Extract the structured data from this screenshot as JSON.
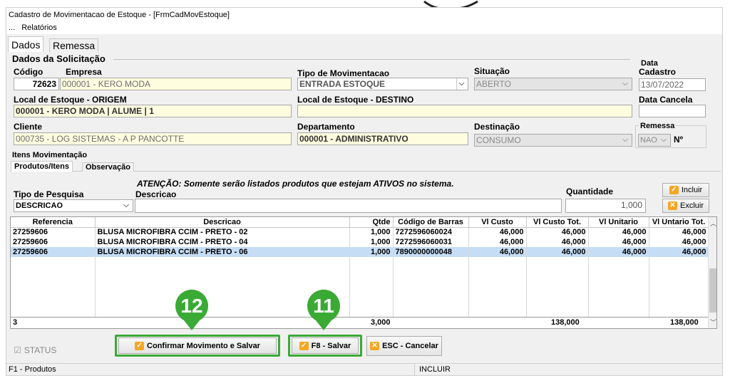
{
  "window": {
    "title": "Cadastro de Movimentacao de Estoque - [FrmCadMovEstoque]"
  },
  "menu": {
    "dots": "...",
    "relatorios": "Relatórios"
  },
  "tabs": {
    "dados": "Dados",
    "remessa": "Remessa"
  },
  "solicitacao": {
    "group_title": "Dados da Solicitação",
    "codigo_label": "Código",
    "codigo_value": "72623",
    "empresa_label": "Empresa",
    "empresa_value": "000001 - KERO MODA",
    "tipo_mov_label": "Tipo de Movimentacao",
    "tipo_mov_value": "ENTRADA ESTOQUE",
    "situacao_label": "Situação",
    "situacao_value": "ABERTO",
    "data_label_1": "Data",
    "data_label_2": "Cadastro",
    "data_value": "13/07/2022",
    "local_origem_label": "Local de Estoque - ORIGEM",
    "local_origem_value": "000001 - KERO MODA | ALUME | 1",
    "local_destino_label": "Local de Estoque - DESTINO",
    "local_destino_value": "",
    "data_cancela_label": "Data Cancela",
    "data_cancela_value": "",
    "cliente_label": "Cliente",
    "cliente_value": "000735 - LOG SISTEMAS - A P PANCOTTE",
    "departamento_label": "Departamento",
    "departamento_value": "000001 - ADMINISTRATIVO",
    "destinacao_label": "Destinação",
    "destinacao_value": "CONSUMO",
    "remessa_label": "Remessa",
    "remessa_value": "NAO",
    "numero_label": "Nº"
  },
  "itens": {
    "group_title": "Itens Movimentação",
    "subtab_produtos": "Produtos/Itens",
    "subtab_observacao": "Observação",
    "atencao": "ATENÇÃO: Somente serão listados produtos que estejam ATIVOS no sistema.",
    "tipo_pesquisa_label": "Tipo de Pesquisa",
    "tipo_pesquisa_value": "DESCRICAO",
    "descricao_label": "Descricao",
    "descricao_value": "",
    "quantidade_label": "Quantidade",
    "quantidade_value": "1,000",
    "incluir_label": "Incluir",
    "excluir_label": "Excluir"
  },
  "grid": {
    "columns": [
      "Referencia",
      "Descricao",
      "Qtde",
      "Código de Barras",
      "Vl Custo",
      "Vl Custo Tot.",
      "Vl Unitario",
      "Vl Untario Tot."
    ],
    "rows": [
      [
        "27259606",
        "BLUSA MICROFIBRA CCIM - PRETO - 02",
        "1,000",
        "7272596060024",
        "46,000",
        "46,000",
        "46,000",
        "46,000"
      ],
      [
        "27259606",
        "BLUSA MICROFIBRA CCIM - PRETO - 04",
        "1,000",
        "7272596060031",
        "46,000",
        "46,000",
        "46,000",
        "46,000"
      ],
      [
        "27259606",
        "BLUSA MICROFIBRA CCIM - PRETO - 06",
        "1,000",
        "7890000000048",
        "46,000",
        "46,000",
        "46,000",
        "46,000"
      ]
    ],
    "selected_row": 2,
    "footer": {
      "count": "3",
      "qtde": "3,000",
      "custo_tot": "138,000",
      "unitario_tot": "138,000"
    }
  },
  "actions": {
    "status_label": "STATUS",
    "confirmar_label": "Confirmar Movimento e Salvar",
    "salvar_label": "F8 - Salvar",
    "cancelar_label": "ESC - Cancelar"
  },
  "markers": {
    "confirmar": "12",
    "salvar": "11"
  },
  "statusbar": {
    "left": "F1 - Produtos",
    "mode": "INCLUIR"
  },
  "colors": {
    "marker_green": "#3aaa35",
    "selected_row": "#c6ddf6",
    "readonly_yellow": "#fffde0"
  }
}
